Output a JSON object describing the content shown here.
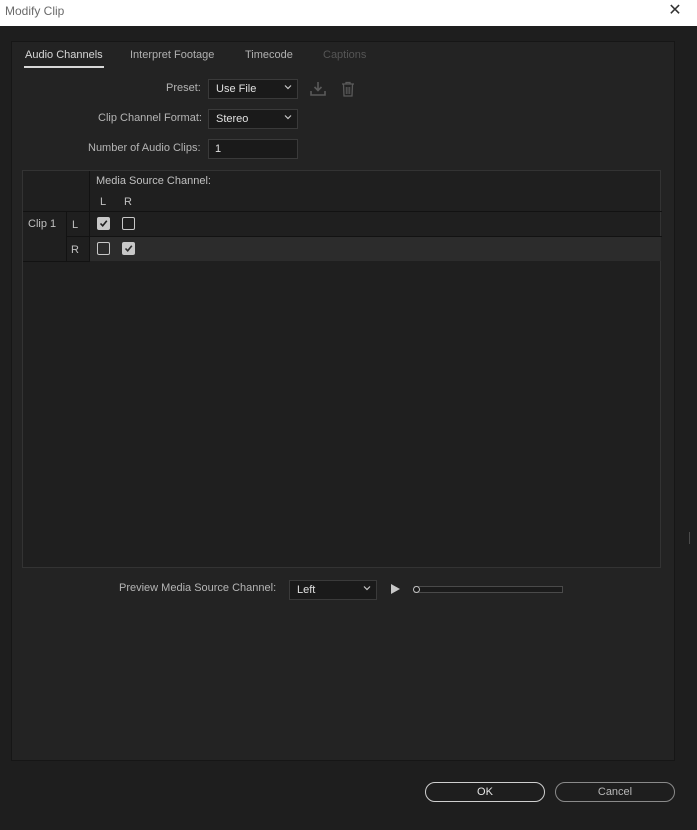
{
  "window": {
    "title": "Modify Clip",
    "close_glyph": "✕"
  },
  "tabs": [
    {
      "label": "Audio Channels",
      "state": "active"
    },
    {
      "label": "Interpret Footage",
      "state": "normal"
    },
    {
      "label": "Timecode",
      "state": "normal"
    },
    {
      "label": "Captions",
      "state": "disabled"
    }
  ],
  "form": {
    "preset_label": "Preset:",
    "preset_value": "Use File",
    "format_label": "Clip Channel Format:",
    "format_value": "Stereo",
    "clips_label": "Number of Audio Clips:",
    "clips_value": "1"
  },
  "channel_grid": {
    "header": "Media Source Channel:",
    "source_channels": [
      "L",
      "R"
    ],
    "clip_name": "Clip 1",
    "rows": [
      {
        "channel": "L",
        "checks": [
          true,
          false
        ]
      },
      {
        "channel": "R",
        "checks": [
          false,
          true
        ]
      }
    ]
  },
  "preview": {
    "label": "Preview Media Source Channel:",
    "value": "Left",
    "position": 0
  },
  "buttons": {
    "ok": "OK",
    "cancel": "Cancel"
  },
  "icons": {
    "close": "close-icon",
    "save_preset": "download-icon",
    "delete_preset": "trash-icon",
    "dropdown": "chevron-down-icon",
    "play": "play-icon",
    "check": "check-icon"
  },
  "colors": {
    "background": "#1e1e1e",
    "panel": "#232323",
    "text": "#b8b8b8",
    "accent": "#d8d8d8"
  }
}
